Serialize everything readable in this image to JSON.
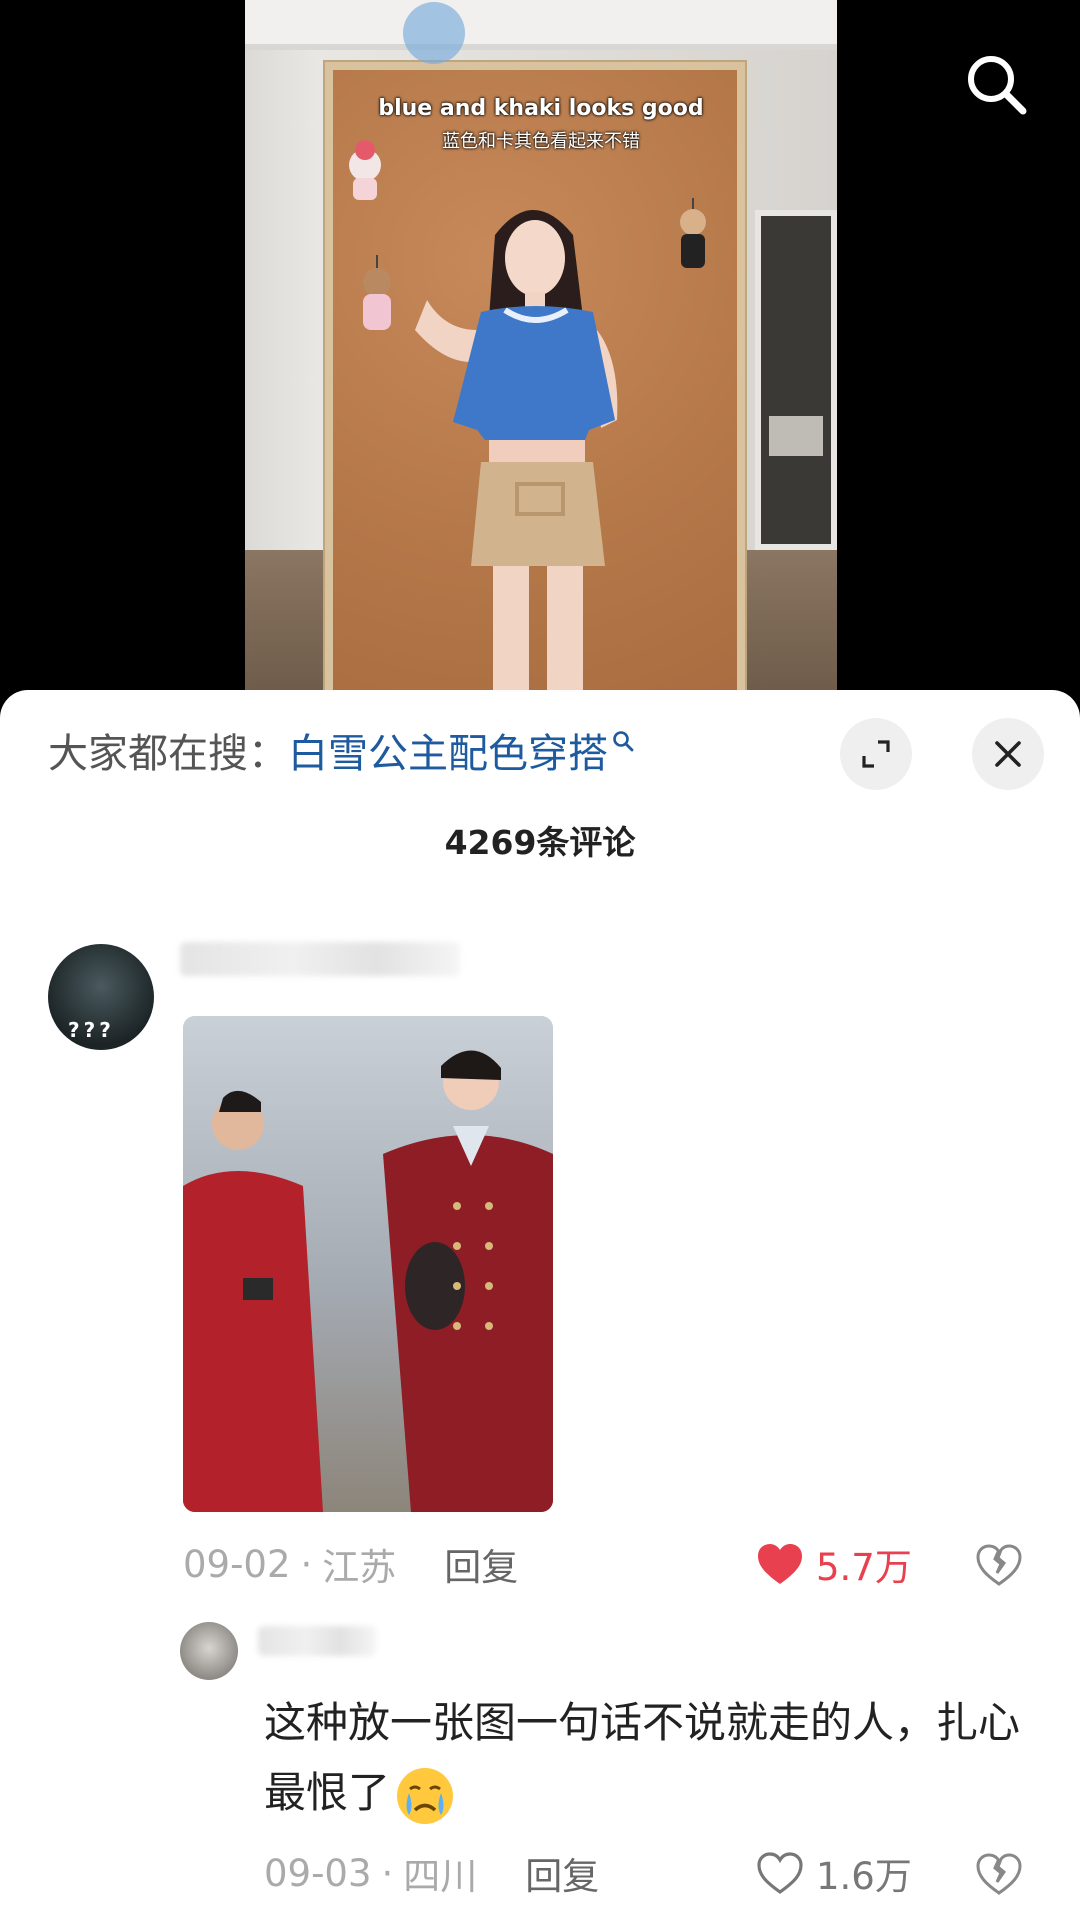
{
  "video": {
    "caption_en": "blue and khaki looks good",
    "caption_zh": "蓝色和卡其色看起来不错"
  },
  "sheet": {
    "trend_prefix": "大家都在搜：",
    "trend_keyword": "白雪公主配色穿搭",
    "comment_count": "4269条评论"
  },
  "comments": [
    {
      "date": "09-02",
      "separator": "·",
      "location": "江苏",
      "reply_label": "回复",
      "likes": "5.7万",
      "liked": true,
      "avatar_marks": "???"
    },
    {
      "text": "这种放一张图一句话不说就走的人，扎心最恨了",
      "emoji": "crying-face",
      "date": "09-03",
      "separator": "·",
      "location": "四川",
      "reply_label": "回复",
      "likes": "1.6万",
      "liked": false
    }
  ],
  "colors": {
    "accent_like": "#e8404f",
    "keyword_blue": "#1e5a9e"
  }
}
